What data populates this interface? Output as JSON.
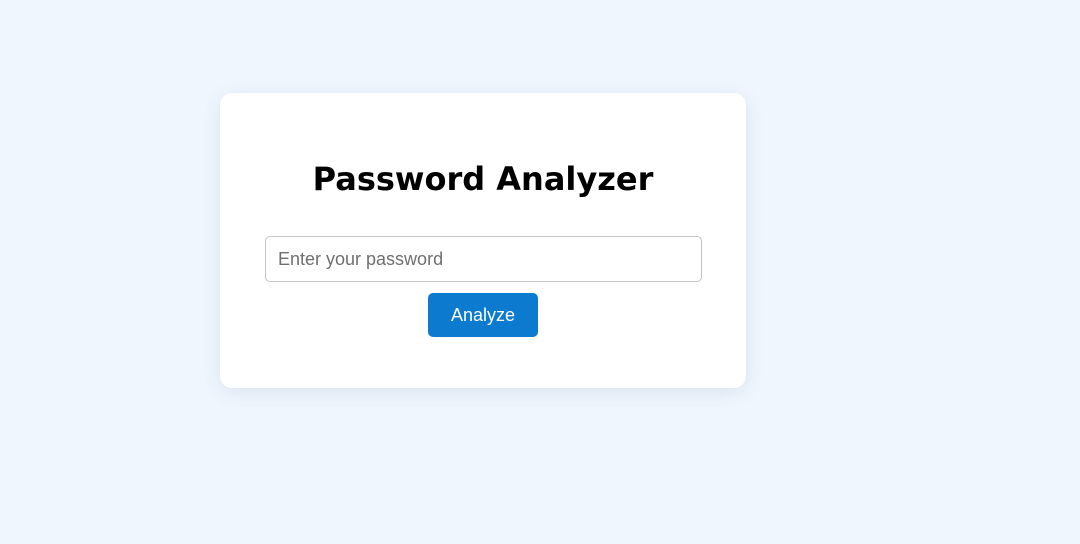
{
  "card": {
    "title": "Password Analyzer",
    "password_input": {
      "value": "",
      "placeholder": "Enter your password"
    },
    "analyze_label": "Analyze"
  },
  "colors": {
    "page_background": "#f0f6fe",
    "card_background": "#ffffff",
    "button_background": "#0b7acf",
    "button_text": "#ffffff"
  }
}
